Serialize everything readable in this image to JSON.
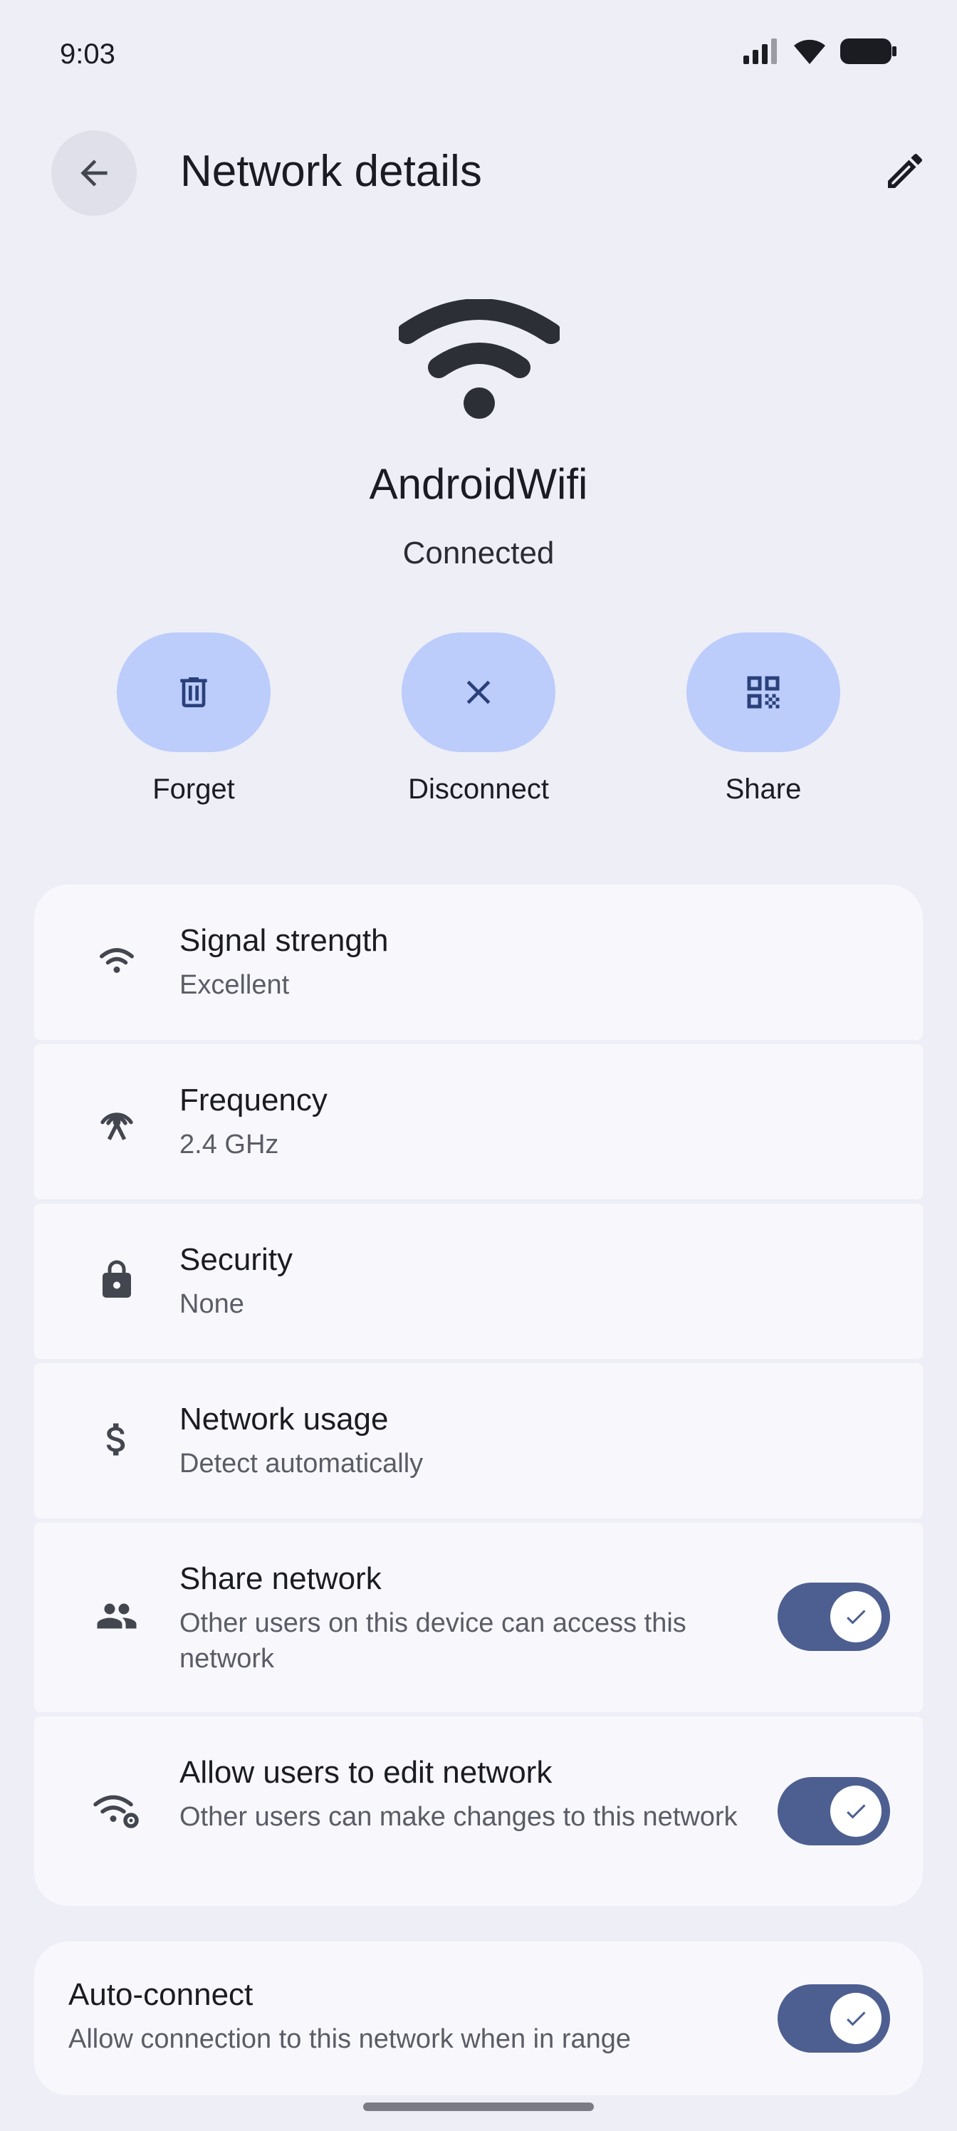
{
  "status_bar": {
    "time": "9:03"
  },
  "app_bar": {
    "title": "Network details"
  },
  "network": {
    "name": "AndroidWifi",
    "status": "Connected"
  },
  "actions": [
    {
      "label": "Forget",
      "icon": "delete-icon"
    },
    {
      "label": "Disconnect",
      "icon": "close-icon"
    },
    {
      "label": "Share",
      "icon": "qr-code-icon"
    }
  ],
  "details": [
    {
      "title": "Signal strength",
      "subtitle": "Excellent",
      "icon": "wifi-icon"
    },
    {
      "title": "Frequency",
      "subtitle": "2.4 GHz",
      "icon": "antenna-icon"
    },
    {
      "title": "Security",
      "subtitle": "None",
      "icon": "lock-icon"
    },
    {
      "title": "Network usage",
      "subtitle": "Detect automatically",
      "icon": "dollar-icon"
    },
    {
      "title": "Share network",
      "subtitle": "Other users on this device can access this network",
      "icon": "people-icon",
      "toggle": true
    },
    {
      "title": "Allow users to edit network",
      "subtitle": "Other users can make changes to this network",
      "icon": "wifi-settings-icon",
      "toggle": true
    }
  ],
  "auto_connect": {
    "title": "Auto-connect",
    "subtitle": "Allow connection to this network when in range",
    "toggle": true
  },
  "colors": {
    "background": "#edeef6",
    "card": "#f8f8fc",
    "action_pill": "#bcccfb",
    "toggle_on": "#4d5f90"
  }
}
